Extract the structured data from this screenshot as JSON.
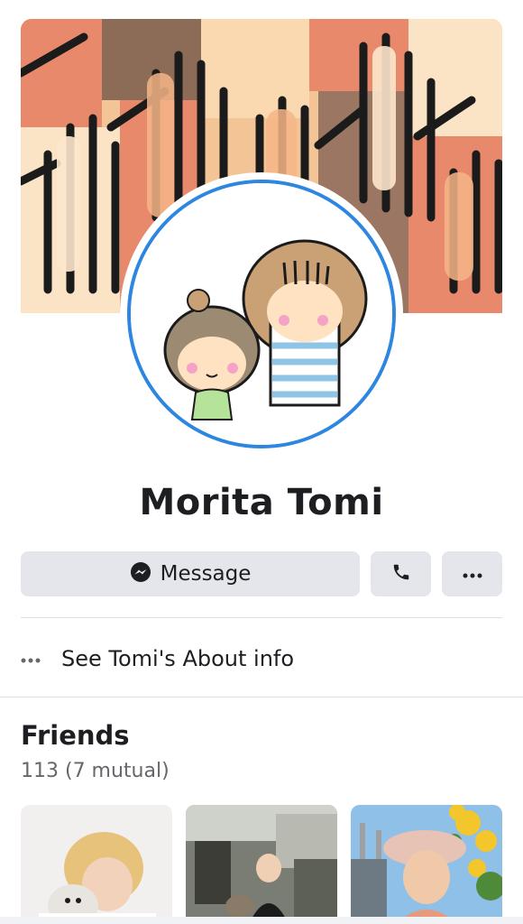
{
  "profile": {
    "name": "Morita Tomi",
    "cover_description": "hands-pattern-cover",
    "avatar_description": "cartoon-children-avatar"
  },
  "actions": {
    "message_label": "Message",
    "call_icon": "phone-icon",
    "more_icon": "more-icon"
  },
  "about": {
    "label": "See Tomi's About info"
  },
  "friends": {
    "title": "Friends",
    "count": "113 (7 mutual)",
    "items": [
      {
        "name": ""
      },
      {
        "name": ""
      },
      {
        "name": ""
      }
    ]
  },
  "colors": {
    "accent": "#2d86e0",
    "button_bg": "#e4e6eb",
    "secondary_text": "#65676b"
  }
}
